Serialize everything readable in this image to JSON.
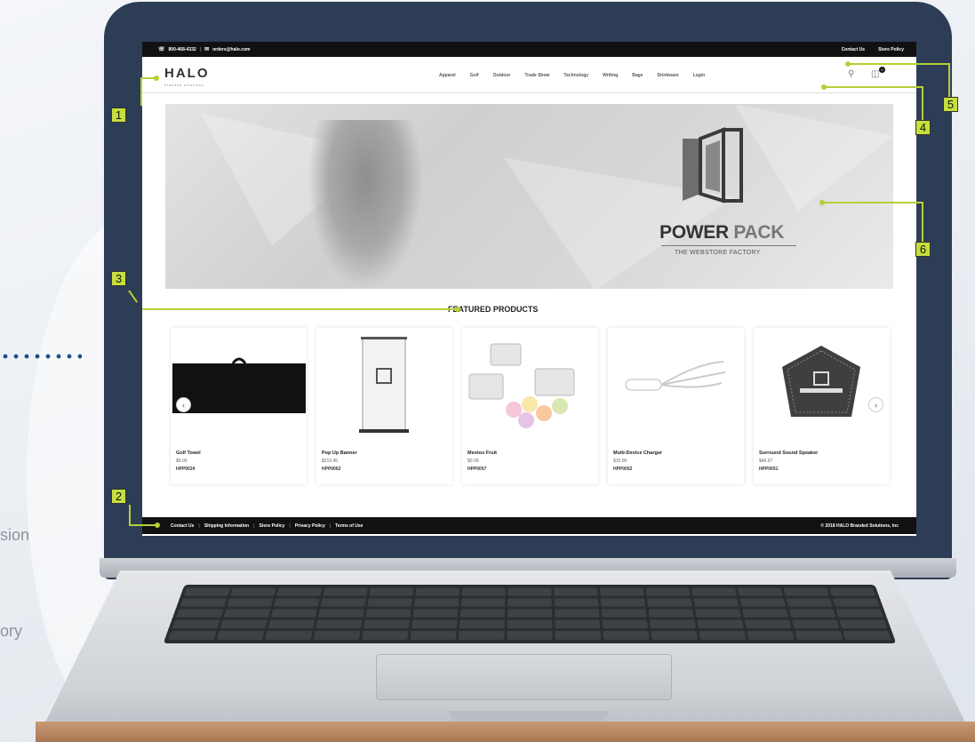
{
  "background": {
    "side_text_1": "sion",
    "side_text_2": "ory"
  },
  "colors": {
    "laptop_bezel": "#2e3d56",
    "callout": "#c6df3d",
    "topbar": "#111111"
  },
  "webstore": {
    "topbar": {
      "phone_icon": "headset-icon",
      "phone": "800-468-4332",
      "email_icon": "mail-icon",
      "email": "orders@halo.com",
      "links": [
        "Contact Us",
        "Store Policy"
      ]
    },
    "logo": {
      "text": "HALO",
      "tagline": "branded solutions"
    },
    "nav": {
      "items": [
        "Apparel",
        "Golf",
        "Outdoor",
        "Trade Show",
        "Technology",
        "Writing",
        "Bags",
        "Drinkware"
      ],
      "login": "Login",
      "search_icon": "search-icon",
      "cart_icon": "cart-icon",
      "cart_count": "0"
    },
    "hero": {
      "title_bold": "POWER",
      "title_light": "PACK",
      "subtitle": "THE WEBSTORE FACTORY"
    },
    "featured": {
      "title": "FEATURED PRODUCTS",
      "products": [
        {
          "name": "Golf Towel",
          "price": "$6.00",
          "sku": "HPP0024"
        },
        {
          "name": "Pop Up Banner",
          "price": "$210.45",
          "sku": "HPP0062"
        },
        {
          "name": "Mentos Fruit",
          "price": "$0.09",
          "sku": "HPP0057"
        },
        {
          "name": "Multi-Device Charger",
          "price": "$15.00",
          "sku": "HPP0052"
        },
        {
          "name": "Surround Sound Speaker",
          "price": "$46.67",
          "sku": "HPP0051"
        }
      ],
      "prev_icon": "chevron-left-icon",
      "next_icon": "chevron-right-icon"
    },
    "footer": {
      "links": [
        "Contact Us",
        "Shipping Information",
        "Store Policy",
        "Privacy Policy",
        "Terms of Use"
      ],
      "copyright": "© 2018 HALO Branded Solutions, Inc"
    }
  },
  "callouts": [
    "1",
    "2",
    "3",
    "4",
    "5",
    "6"
  ]
}
